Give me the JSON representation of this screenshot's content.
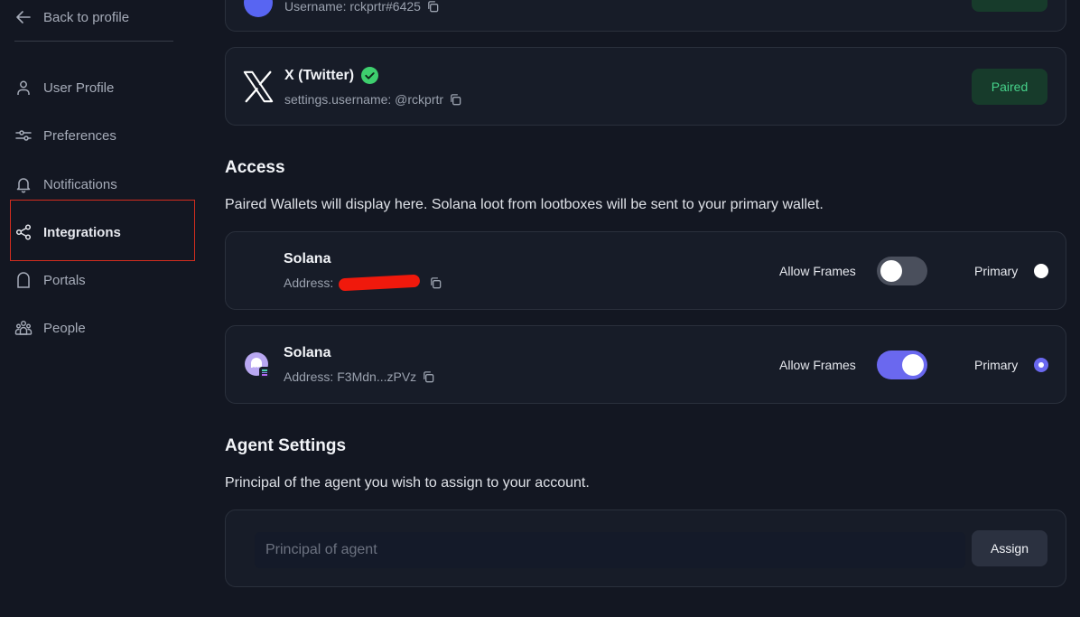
{
  "sidebar": {
    "back_label": "Back to profile",
    "items": [
      {
        "label": "User Profile",
        "icon": "user-icon"
      },
      {
        "label": "Preferences",
        "icon": "sliders-icon"
      },
      {
        "label": "Notifications",
        "icon": "bell-icon"
      },
      {
        "label": "Integrations",
        "icon": "share-icon",
        "active": true
      },
      {
        "label": "Portals",
        "icon": "portal-icon"
      },
      {
        "label": "People",
        "icon": "people-icon"
      }
    ]
  },
  "integrations": {
    "discord_partial": {
      "username_text": "Username: rckprtr#6425"
    },
    "twitter": {
      "name": "X (Twitter)",
      "username_text": "settings.username: @rckprtr",
      "status_button": "Paired",
      "verified": true
    }
  },
  "access": {
    "heading": "Access",
    "description": "Paired Wallets will display here. Solana loot from lootboxes will be sent to your primary wallet.",
    "wallets": [
      {
        "name": "Solana",
        "address_label": "Address:",
        "address_value": "",
        "address_redacted": true,
        "allow_frames_label": "Allow Frames",
        "allow_frames": false,
        "primary_label": "Primary",
        "primary": false
      },
      {
        "name": "Solana",
        "address_label": "Address:",
        "address_value": "F3Mdn...zPVz",
        "address_redacted": false,
        "allow_frames_label": "Allow Frames",
        "allow_frames": true,
        "primary_label": "Primary",
        "primary": true
      }
    ]
  },
  "agent_settings": {
    "heading": "Agent Settings",
    "description": "Principal of the agent you wish to assign to your account.",
    "input_placeholder": "Principal of agent",
    "input_value": "",
    "assign_label": "Assign"
  },
  "colors": {
    "background": "#131722",
    "card": "#171c28",
    "accent": "#6a68ef",
    "paired_bg": "#173b2b",
    "paired_text": "#46d28a",
    "verified": "#3ecf6e",
    "annotation_box": "#d22d1f"
  }
}
